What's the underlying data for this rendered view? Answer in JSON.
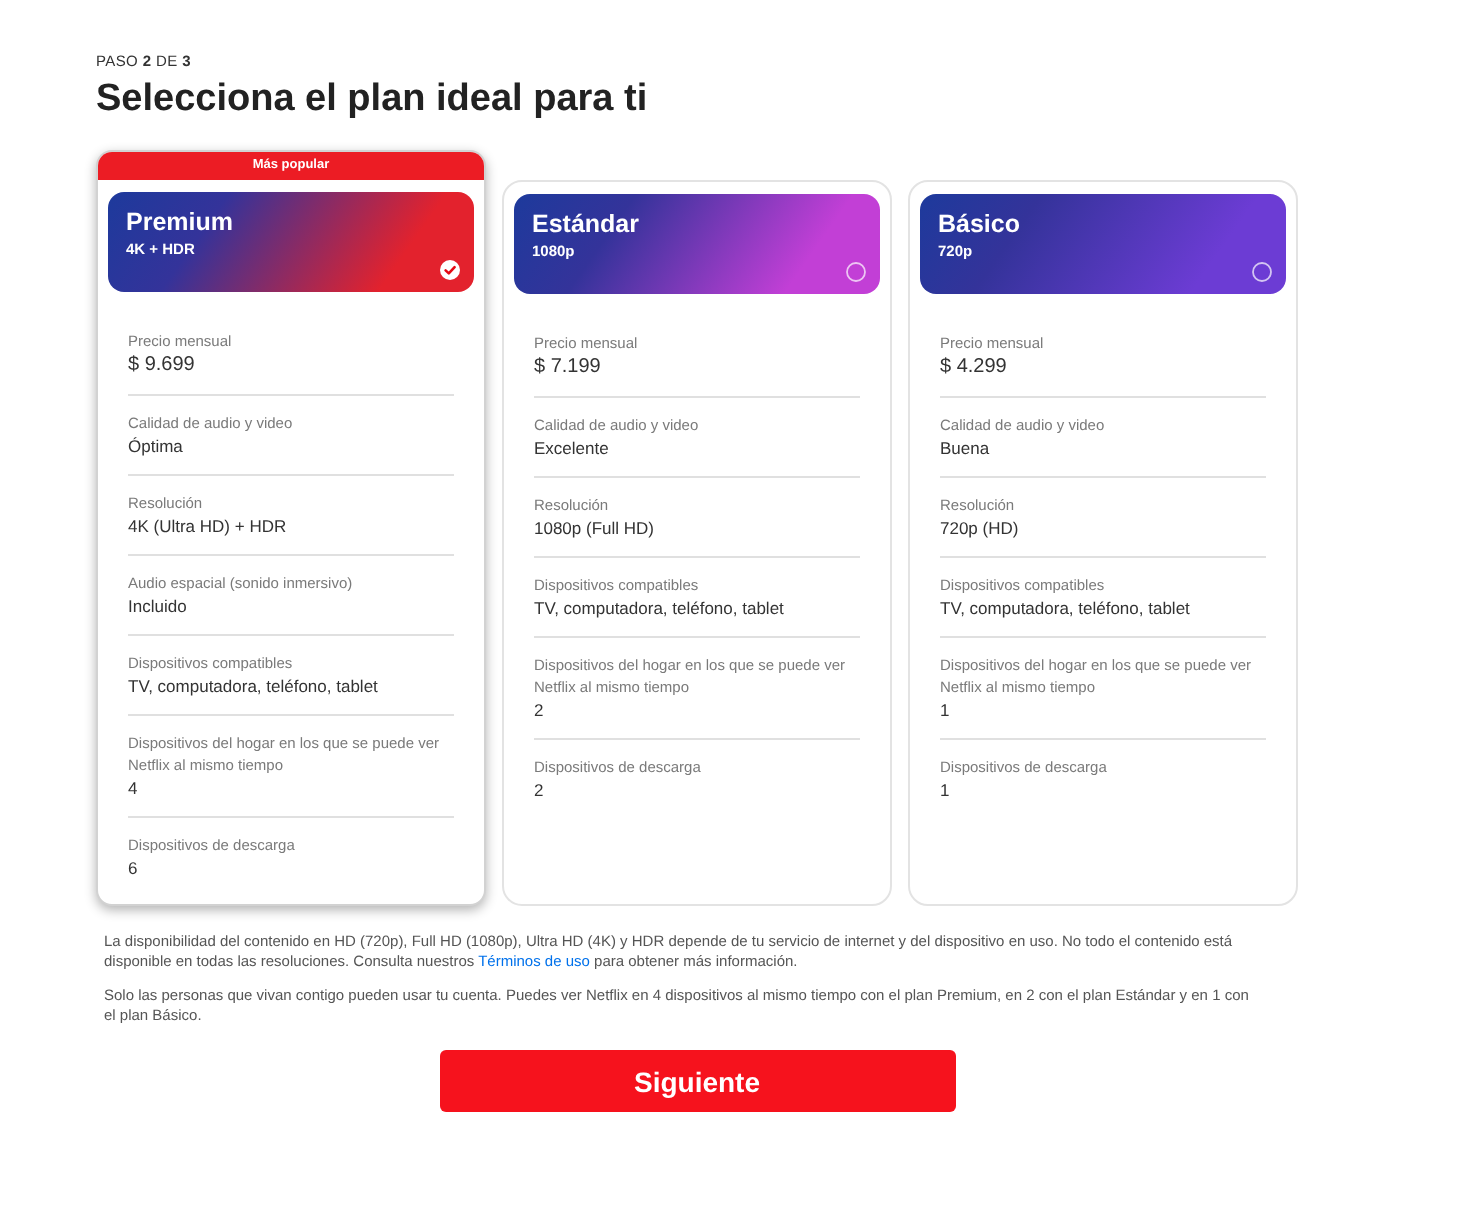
{
  "header": {
    "step": "PASO **2** DE **3**",
    "title": "Selecciona el plan ideal para ti"
  },
  "plans": [
    {
      "badge": "Más popular",
      "name": "Premium",
      "resolution": "4K + HDR",
      "color": "#e3222d",
      "selected": true,
      "price": {
        "label": "Precio mensual",
        "value": "$ 9.699"
      },
      "features": [
        {
          "label": "Calidad de audio y video",
          "value": "Óptima"
        },
        {
          "label": "Resolución",
          "value": "4K (Ultra HD) + HDR"
        },
        {
          "label": "Audio espacial (sonido inmersivo)",
          "value": "Incluido"
        },
        {
          "label": "Dispositivos compatibles",
          "value": "TV, computadora, teléfono, tablet"
        },
        {
          "label": "Dispositivos del hogar en los que se puede ver Netflix al mismo tiempo",
          "value": "4"
        },
        {
          "label": "Dispositivos de descarga",
          "value": "6"
        }
      ]
    },
    {
      "name": "Estándar",
      "resolution": "1080p",
      "color": "#c23fd6",
      "selected": false,
      "price": {
        "label": "Precio mensual",
        "value": "$ 7.199"
      },
      "features": [
        {
          "label": "Calidad de audio y video",
          "value": "Excelente"
        },
        {
          "label": "Resolución",
          "value": "1080p (Full HD)"
        },
        {
          "label": "Dispositivos compatibles",
          "value": "TV, computadora, teléfono, tablet"
        },
        {
          "label": "Dispositivos del hogar en los que se puede ver Netflix al mismo tiempo",
          "value": "2"
        },
        {
          "label": "Dispositivos de descarga",
          "value": "2"
        }
      ]
    },
    {
      "name": "Básico",
      "resolution": "720p",
      "color": "#6c3cd4",
      "selected": false,
      "price": {
        "label": "Precio mensual",
        "value": "$ 4.299"
      },
      "features": [
        {
          "label": "Calidad de audio y video",
          "value": "Buena"
        },
        {
          "label": "Resolución",
          "value": "720p (HD)"
        },
        {
          "label": "Dispositivos compatibles",
          "value": "TV, computadora, teléfono, tablet"
        },
        {
          "label": "Dispositivos del hogar en los que se puede ver Netflix al mismo tiempo",
          "value": "1"
        },
        {
          "label": "Dispositivos de descarga",
          "value": "1"
        }
      ]
    }
  ],
  "notes": [
    {
      "text": "La disponibilidad del contenido en HD (720p), Full HD (1080p), Ultra HD (4K) y HDR depende de tu servicio de internet y del dispositivo en uso. No todo el contenido está disponible en todas las resoluciones. Consulta nuestros",
      "link": "Términos de uso",
      "text_after": "para obtener más información."
    },
    {
      "text": "Solo las personas que vivan contigo pueden usar tu cuenta. Puedes ver Netflix en 4 dispositivos al mismo tiempo con el plan Premium, en 2 con el plan Estándar y en 1 con el plan Básico."
    }
  ],
  "button": {
    "label": "Siguiente"
  }
}
